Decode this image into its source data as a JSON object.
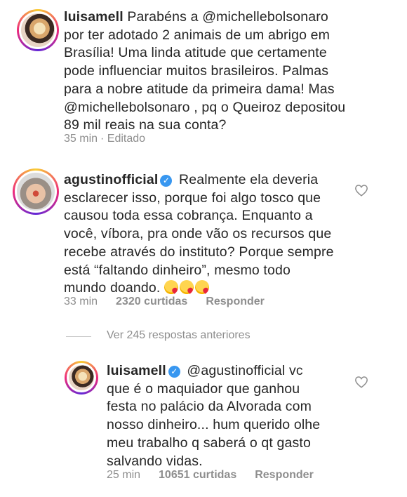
{
  "comments": [
    {
      "username": "luisamell",
      "verified": false,
      "lines": [
        "Parabéns a @michellebolsonaro",
        "por ter adotado 2 animais de um abrigo em",
        "Brasília! Uma linda atitude que certamente",
        "pode influenciar muitos brasileiros. Palmas",
        "para a nobre atitude da primeira dama! Mas",
        "@michellebolsonaro , pq o Queiroz depositou",
        "89 mil reais na sua conta?"
      ],
      "time": "35 min",
      "edited": "· Editado"
    },
    {
      "username": "agustinofficial",
      "verified": true,
      "lines": [
        "Realmente ela deveria",
        "esclarecer isso, porque foi algo tosco que",
        "causou toda essa cobrança. Enquanto a",
        "você, víbora, pra onde vão os recursos que",
        "recebe através do instituto? Porque sempre",
        "está “faltando dinheiro”, mesmo todo",
        "mundo doando."
      ],
      "emoji_count": 3,
      "time": "33 min",
      "likes": "2320 curtidas",
      "reply": "Responder"
    },
    {
      "username": "luisamell",
      "verified": true,
      "lines": [
        "@agustinofficial vc",
        "que é o maquiador que ganhou",
        "festa no palácio da Alvorada com",
        "nosso dinheiro... hum querido olhe",
        "meu trabalho q  saberá o qt gasto",
        "salvando vidas."
      ],
      "time": "25 min",
      "likes": "10651 curtidas",
      "reply": "Responder"
    }
  ],
  "view_replies": "Ver 245 respostas anteriores",
  "colors": {
    "text": "#262626",
    "meta": "#8e8e8e",
    "verified": "#3897f0"
  }
}
